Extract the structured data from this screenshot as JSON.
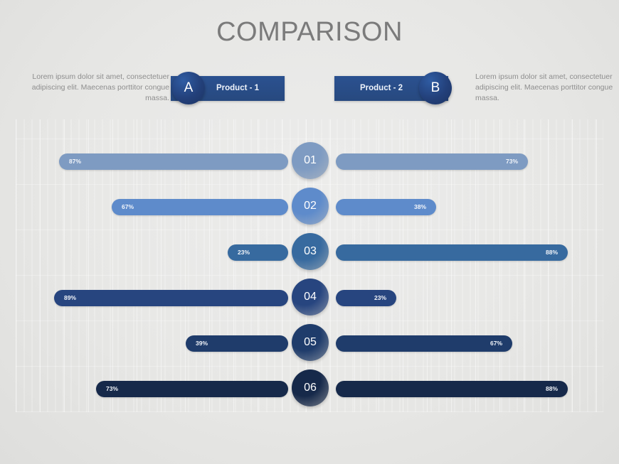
{
  "title": "COMPARISON",
  "legend": {
    "left": {
      "description": "Lorem ipsum dolor sit amet, consectetuer adipiscing elit. Maecenas porttitor congue massa.",
      "badge": "A",
      "label": "Product - 1"
    },
    "right": {
      "description": "Lorem ipsum dolor sit amet, consectetuer adipiscing elit. Maecenas porttitor congue massa.",
      "badge": "B",
      "label": "Product - 2"
    }
  },
  "chart_data": {
    "type": "bar",
    "title": "COMPARISON",
    "orientation": "horizontal-diverging",
    "categories": [
      "01",
      "02",
      "03",
      "04",
      "05",
      "06"
    ],
    "xlabel": "",
    "ylabel": "",
    "xlim": [
      0,
      100
    ],
    "grid": false,
    "legend_position": "top",
    "value_suffix": "%",
    "series": [
      {
        "name": "Product - 1",
        "side": "left",
        "values": [
          87,
          67,
          23,
          89,
          39,
          73
        ],
        "labels": [
          "87%",
          "67%",
          "23%",
          "89%",
          "39%",
          "73%"
        ]
      },
      {
        "name": "Product - 2",
        "side": "right",
        "values": [
          73,
          38,
          88,
          23,
          67,
          88
        ],
        "labels": [
          "73%",
          "38%",
          "88%",
          "23%",
          "67%",
          "88%"
        ]
      }
    ],
    "row_colors": [
      "#7e9bc2",
      "#5e8bcb",
      "#376a9f",
      "#27457f",
      "#1f3c6b",
      "#16294a"
    ]
  },
  "colors": {
    "background": "#e9e9e7",
    "title_text": "#7b7b7b",
    "legend_text": "#8e8e8e",
    "pill": "#2b5190",
    "badge": "#23407a",
    "value_text": "#f2f5fa"
  }
}
